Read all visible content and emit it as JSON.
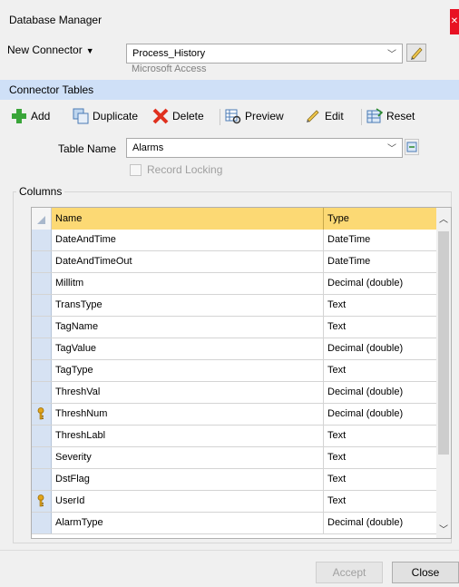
{
  "window": {
    "title": "Database Manager"
  },
  "connector": {
    "menu_label": "New Connector",
    "selected": "Process_History",
    "provider": "Microsoft Access"
  },
  "section": {
    "title": "Connector Tables"
  },
  "toolbar": {
    "add": "Add",
    "duplicate": "Duplicate",
    "delete": "Delete",
    "preview": "Preview",
    "edit": "Edit",
    "reset": "Reset"
  },
  "table": {
    "label": "Table Name",
    "selected": "Alarms",
    "record_locking": "Record Locking"
  },
  "columns": {
    "group_label": "Columns",
    "headers": {
      "name": "Name",
      "type": "Type"
    },
    "rows": [
      {
        "name": "DateAndTime",
        "type": "DateTime",
        "key": false
      },
      {
        "name": "DateAndTimeOut",
        "type": "DateTime",
        "key": false
      },
      {
        "name": "Millitm",
        "type": "Decimal (double)",
        "key": false
      },
      {
        "name": "TransType",
        "type": "Text",
        "key": false
      },
      {
        "name": "TagName",
        "type": "Text",
        "key": false
      },
      {
        "name": "TagValue",
        "type": "Decimal (double)",
        "key": false
      },
      {
        "name": "TagType",
        "type": "Text",
        "key": false
      },
      {
        "name": "ThreshVal",
        "type": "Decimal (double)",
        "key": false
      },
      {
        "name": "ThreshNum",
        "type": "Decimal (double)",
        "key": true
      },
      {
        "name": "ThreshLabl",
        "type": "Text",
        "key": false
      },
      {
        "name": "Severity",
        "type": "Text",
        "key": false
      },
      {
        "name": "DstFlag",
        "type": "Text",
        "key": false
      },
      {
        "name": "UserId",
        "type": "Text",
        "key": true
      },
      {
        "name": "AlarmType",
        "type": "Decimal (double)",
        "key": false
      }
    ]
  },
  "buttons": {
    "accept": "Accept",
    "close": "Close"
  },
  "colors": {
    "header_gold": "#fcd974",
    "section_blue": "#cfe0f7",
    "row_header": "#d6e2f3"
  }
}
